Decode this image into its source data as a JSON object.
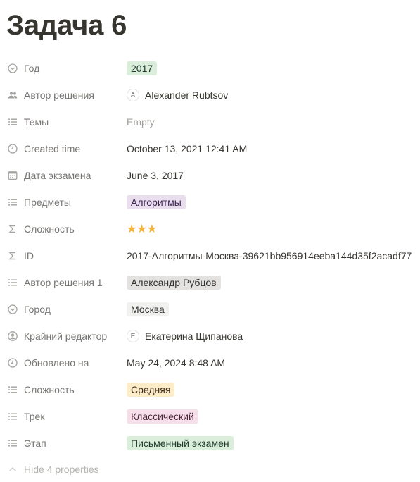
{
  "page": {
    "title": "Задача 6"
  },
  "properties": [
    {
      "name": "Год",
      "icon": "select-icon",
      "value": "2017",
      "kind": "tag",
      "color": "#dbeddb"
    },
    {
      "name": "Автор решения",
      "icon": "people-icon",
      "value": "Alexander Rubtsov",
      "kind": "person",
      "avatar": "A"
    },
    {
      "name": "Темы",
      "icon": "list-icon",
      "value": "Empty",
      "kind": "empty"
    },
    {
      "name": "Created time",
      "icon": "clock-icon",
      "value": "October 13, 2021 12:41 AM",
      "kind": "text"
    },
    {
      "name": "Дата экзамена",
      "icon": "calendar-icon",
      "value": "June 3, 2017",
      "kind": "text"
    },
    {
      "name": "Предметы",
      "icon": "list-icon",
      "value": "Алгоритмы",
      "kind": "tag",
      "color": "#e8deee"
    },
    {
      "name": "Сложность",
      "icon": "formula-icon",
      "value": "★★★",
      "kind": "stars",
      "rating": 3
    },
    {
      "name": "ID",
      "icon": "formula-icon",
      "value": "2017-Алгоритмы-Москва-39621bb956914eeba144d35f2acadf77",
      "kind": "text"
    },
    {
      "name": "Автор решения 1",
      "icon": "list-icon",
      "value": "Александр Рубцов",
      "kind": "tag",
      "color": "#e3e2e0"
    },
    {
      "name": "Город",
      "icon": "select-icon",
      "value": "Москва",
      "kind": "tag",
      "color": "#f1f1ef"
    },
    {
      "name": "Крайний редактор",
      "icon": "person-circle-icon",
      "value": "Екатерина Щипанова",
      "kind": "person",
      "avatar": "Е"
    },
    {
      "name": "Обновлено на",
      "icon": "clock-icon",
      "value": "May 24, 2024 8:48 AM",
      "kind": "text"
    },
    {
      "name": "Сложность",
      "icon": "list-icon",
      "value": "Средняя",
      "kind": "tag",
      "color": "#fdecc8"
    },
    {
      "name": "Трек",
      "icon": "list-icon",
      "value": "Классический",
      "kind": "tag",
      "color": "#f5e0e9"
    },
    {
      "name": "Этап",
      "icon": "list-icon",
      "value": "Письменный экзамен",
      "kind": "tag",
      "color": "#dbeddb"
    }
  ],
  "hide_properties": {
    "label": "Hide 4 properties",
    "icon": "chevron-up-icon"
  }
}
